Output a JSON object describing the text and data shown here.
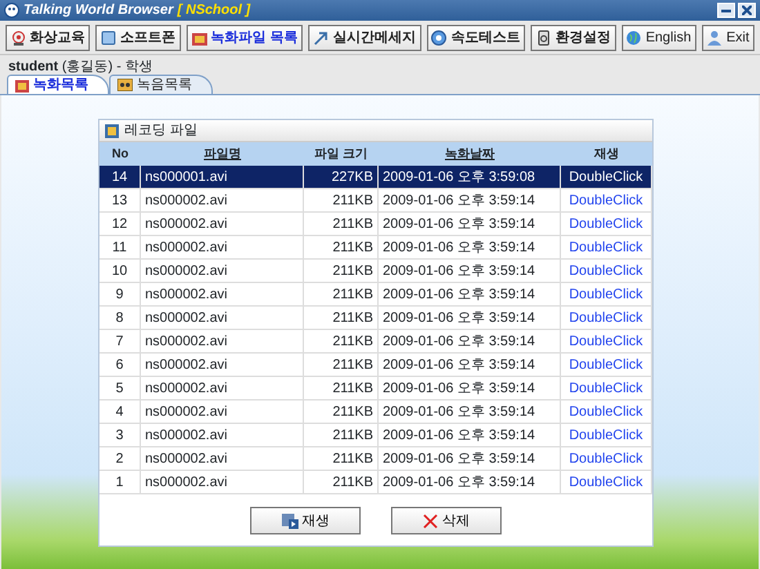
{
  "window": {
    "title": "Talking World Browser",
    "subtitle": "[ NSchool ]"
  },
  "toolbar": [
    {
      "label": "화상교육",
      "selected": false
    },
    {
      "label": "소프트폰",
      "selected": false
    },
    {
      "label": "녹화파일 목록",
      "selected": true
    },
    {
      "label": "실시간메세지",
      "selected": false
    },
    {
      "label": "속도테스트",
      "selected": false
    },
    {
      "label": "환경설정",
      "selected": false
    },
    {
      "label": "English",
      "selected": false
    },
    {
      "label": "Exit",
      "selected": false
    }
  ],
  "user": {
    "id": "student",
    "name": "(홍길동) - 학생"
  },
  "tabs": [
    {
      "label": "녹화목록",
      "selected": true
    },
    {
      "label": "녹음목록",
      "selected": false
    }
  ],
  "panel": {
    "title": "레코딩 파일",
    "columns": [
      {
        "label": "No",
        "sortable": false
      },
      {
        "label": "파일명",
        "sortable": true
      },
      {
        "label": "파일 크기",
        "sortable": false
      },
      {
        "label": "녹화날짜",
        "sortable": true
      },
      {
        "label": "재생",
        "sortable": false
      }
    ],
    "rows": [
      {
        "no": "14",
        "file": "ns000001.avi",
        "size": "227KB",
        "date": "2009-01-06 오후 3:59:08",
        "play": "DoubleClick",
        "selected": true
      },
      {
        "no": "13",
        "file": "ns000002.avi",
        "size": "211KB",
        "date": "2009-01-06 오후 3:59:14",
        "play": "DoubleClick",
        "selected": false
      },
      {
        "no": "12",
        "file": "ns000002.avi",
        "size": "211KB",
        "date": "2009-01-06 오후 3:59:14",
        "play": "DoubleClick",
        "selected": false
      },
      {
        "no": "11",
        "file": "ns000002.avi",
        "size": "211KB",
        "date": "2009-01-06 오후 3:59:14",
        "play": "DoubleClick",
        "selected": false
      },
      {
        "no": "10",
        "file": "ns000002.avi",
        "size": "211KB",
        "date": "2009-01-06 오후 3:59:14",
        "play": "DoubleClick",
        "selected": false
      },
      {
        "no": "9",
        "file": "ns000002.avi",
        "size": "211KB",
        "date": "2009-01-06 오후 3:59:14",
        "play": "DoubleClick",
        "selected": false
      },
      {
        "no": "8",
        "file": "ns000002.avi",
        "size": "211KB",
        "date": "2009-01-06 오후 3:59:14",
        "play": "DoubleClick",
        "selected": false
      },
      {
        "no": "7",
        "file": "ns000002.avi",
        "size": "211KB",
        "date": "2009-01-06 오후 3:59:14",
        "play": "DoubleClick",
        "selected": false
      },
      {
        "no": "6",
        "file": "ns000002.avi",
        "size": "211KB",
        "date": "2009-01-06 오후 3:59:14",
        "play": "DoubleClick",
        "selected": false
      },
      {
        "no": "5",
        "file": "ns000002.avi",
        "size": "211KB",
        "date": "2009-01-06 오후 3:59:14",
        "play": "DoubleClick",
        "selected": false
      },
      {
        "no": "4",
        "file": "ns000002.avi",
        "size": "211KB",
        "date": "2009-01-06 오후 3:59:14",
        "play": "DoubleClick",
        "selected": false
      },
      {
        "no": "3",
        "file": "ns000002.avi",
        "size": "211KB",
        "date": "2009-01-06 오후 3:59:14",
        "play": "DoubleClick",
        "selected": false
      },
      {
        "no": "2",
        "file": "ns000002.avi",
        "size": "211KB",
        "date": "2009-01-06 오후 3:59:14",
        "play": "DoubleClick",
        "selected": false
      },
      {
        "no": "1",
        "file": "ns000002.avi",
        "size": "211KB",
        "date": "2009-01-06 오후 3:59:14",
        "play": "DoubleClick",
        "selected": false
      }
    ],
    "buttons": [
      "재생",
      "삭제"
    ]
  }
}
